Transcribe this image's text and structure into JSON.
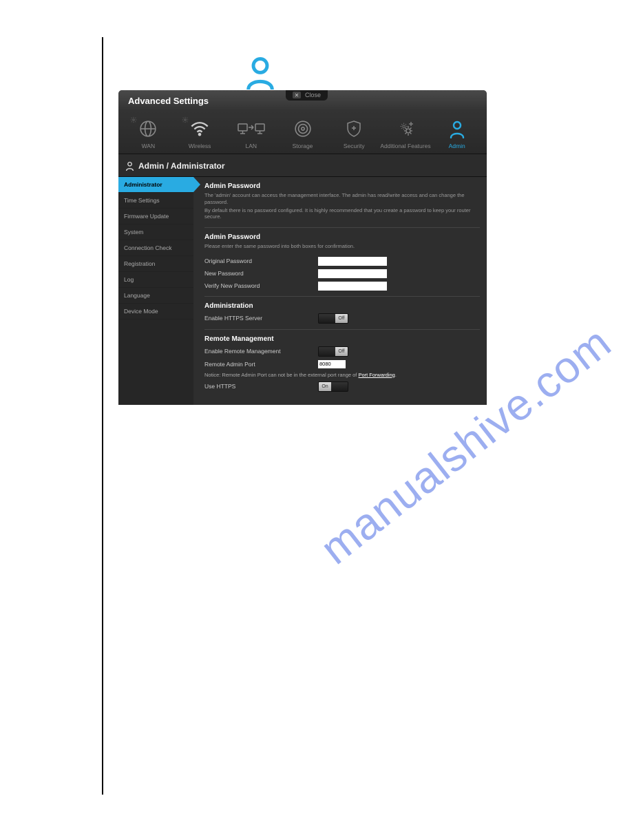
{
  "watermark": "manualshive.com",
  "header": {
    "title": "Advanced Settings",
    "close_label": "Close"
  },
  "nav": {
    "items": [
      {
        "label": "WAN"
      },
      {
        "label": "Wireless"
      },
      {
        "label": "LAN"
      },
      {
        "label": "Storage"
      },
      {
        "label": "Security"
      },
      {
        "label": "Additional Features"
      },
      {
        "label": "Admin"
      }
    ]
  },
  "breadcrumb": "Admin / Administrator",
  "sidebar": {
    "items": [
      {
        "label": "Administrator"
      },
      {
        "label": "Time Settings"
      },
      {
        "label": "Firmware Update"
      },
      {
        "label": "System"
      },
      {
        "label": "Connection Check"
      },
      {
        "label": "Registration"
      },
      {
        "label": "Log"
      },
      {
        "label": "Language"
      },
      {
        "label": "Device Mode"
      }
    ]
  },
  "content": {
    "section1": {
      "title": "Admin Password",
      "desc1": "The 'admin' account can access the management interface. The admin has read/write access and can change the password.",
      "desc2": "By default there is no password configured. It is highly recommended that you create a password to keep your router secure."
    },
    "section2": {
      "title": "Admin Password",
      "subtitle": "Please enter the same password into both boxes for confirmation.",
      "original_label": "Original Password",
      "new_label": "New Password",
      "verify_label": "Verify New Password",
      "original_value": "",
      "new_value": "",
      "verify_value": ""
    },
    "section3": {
      "title": "Administration",
      "https_server_label": "Enable HTTPS Server",
      "https_server_value": "Off"
    },
    "section4": {
      "title": "Remote Management",
      "enable_label": "Enable Remote Management",
      "enable_value": "Off",
      "port_label": "Remote Admin Port",
      "port_value": "8080",
      "notice_prefix": "Notice: Remote Admin Port can not be in the external port range of ",
      "notice_link": "Port Forwarding",
      "notice_suffix": ".",
      "use_https_label": "Use HTTPS",
      "use_https_value": "On"
    }
  }
}
